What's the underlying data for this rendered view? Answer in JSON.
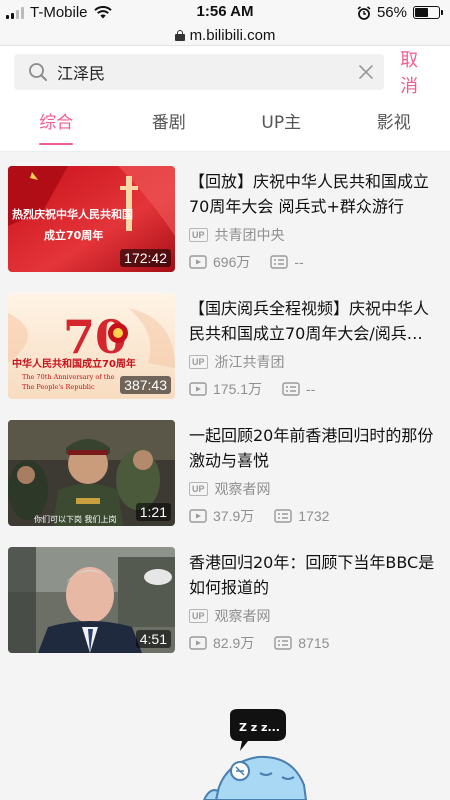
{
  "status_bar": {
    "carrier": "T-Mobile",
    "time": "1:56 AM",
    "battery": "56%"
  },
  "url_bar": {
    "url": "m.bilibili.com"
  },
  "search": {
    "query": "江泽民",
    "cancel_label": "取消"
  },
  "tabs": [
    {
      "label": "综合",
      "active": true
    },
    {
      "label": "番剧",
      "active": false
    },
    {
      "label": "UP主",
      "active": false
    },
    {
      "label": "影视",
      "active": false
    }
  ],
  "videos": [
    {
      "title": "【回放】庆祝中华人民共和国成立70周年大会 阅兵式+群众游行",
      "duration": "172:42",
      "uploader": "共青团中央",
      "views": "696万",
      "danmaku": "--",
      "thumb_text_1": "热烈庆祝中华人民共和国",
      "thumb_text_2": "成立70周年"
    },
    {
      "title": "【国庆阅兵全程视频】庆祝中华人民共和国成立70周年大会/阅兵…",
      "duration": "387:43",
      "uploader": "浙江共青团",
      "views": "175.1万",
      "danmaku": "--",
      "thumb_text_1": "中华人民共和国成立70周年",
      "thumb_text_2": "The 70th Anniversary of the",
      "thumb_text_3": "The People's Republic"
    },
    {
      "title": "一起回顾20年前香港回归时的那份激动与喜悦",
      "duration": "1:21",
      "uploader": "观察者网",
      "views": "37.9万",
      "danmaku": "1732",
      "thumb_text_1": "你们可以下岗 我们上岗"
    },
    {
      "title": "香港回归20年：回顾下当年BBC是如何报道的",
      "duration": "4:51",
      "uploader": "观察者网",
      "views": "82.9万",
      "danmaku": "8715"
    }
  ],
  "badge_label": "UP",
  "mascot": {
    "speech": "Z z z..."
  }
}
